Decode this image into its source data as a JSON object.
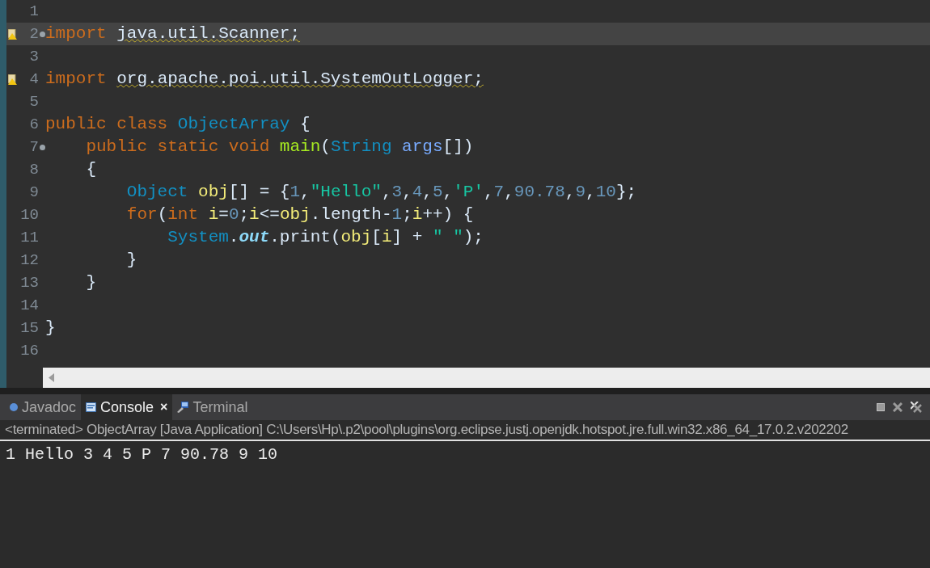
{
  "editor": {
    "lines": [
      {
        "number": "1",
        "current": false,
        "warning": false,
        "fold": false
      },
      {
        "number": "2",
        "current": true,
        "warning": true,
        "fold": true,
        "tokens": [
          {
            "kind": "keyword",
            "text": "import "
          },
          {
            "kind": "warned",
            "text": "java.util.Scanner;"
          }
        ]
      },
      {
        "number": "3",
        "current": false,
        "warning": false,
        "fold": false
      },
      {
        "number": "4",
        "current": false,
        "warning": true,
        "fold": false,
        "tokens": [
          {
            "kind": "keyword",
            "text": "import "
          },
          {
            "kind": "warned",
            "text": "org.apache.poi.util.SystemOutLogger;"
          }
        ]
      },
      {
        "number": "5",
        "current": false,
        "warning": false,
        "fold": false
      },
      {
        "number": "6",
        "current": false,
        "warning": false,
        "fold": false,
        "tokens": [
          {
            "kind": "keyword",
            "text": "public class "
          },
          {
            "kind": "type",
            "text": "ObjectArray"
          },
          {
            "kind": "plain",
            "text": " {"
          }
        ]
      },
      {
        "number": "7",
        "current": false,
        "warning": false,
        "fold": true,
        "tokens": [
          {
            "kind": "keyword",
            "text": "    public static void "
          },
          {
            "kind": "method",
            "text": "main"
          },
          {
            "kind": "plain",
            "text": "("
          },
          {
            "kind": "type",
            "text": "String "
          },
          {
            "kind": "param",
            "text": "args"
          },
          {
            "kind": "plain",
            "text": "[])"
          }
        ]
      },
      {
        "number": "8",
        "current": false,
        "warning": false,
        "fold": false,
        "tokens": [
          {
            "kind": "plain",
            "text": "    {"
          }
        ]
      },
      {
        "number": "9",
        "current": false,
        "warning": false,
        "fold": false,
        "tokens": [
          {
            "kind": "type",
            "text": "        Object "
          },
          {
            "kind": "variable",
            "text": "obj"
          },
          {
            "kind": "plain",
            "text": "[] = {"
          },
          {
            "kind": "number",
            "text": "1"
          },
          {
            "kind": "plain",
            "text": ","
          },
          {
            "kind": "string",
            "text": "\"Hello\""
          },
          {
            "kind": "plain",
            "text": ","
          },
          {
            "kind": "number",
            "text": "3"
          },
          {
            "kind": "plain",
            "text": ","
          },
          {
            "kind": "number",
            "text": "4"
          },
          {
            "kind": "plain",
            "text": ","
          },
          {
            "kind": "number",
            "text": "5"
          },
          {
            "kind": "plain",
            "text": ","
          },
          {
            "kind": "string",
            "text": "'P'"
          },
          {
            "kind": "plain",
            "text": ","
          },
          {
            "kind": "number",
            "text": "7"
          },
          {
            "kind": "plain",
            "text": ","
          },
          {
            "kind": "number",
            "text": "90.78"
          },
          {
            "kind": "plain",
            "text": ","
          },
          {
            "kind": "number",
            "text": "9"
          },
          {
            "kind": "plain",
            "text": ","
          },
          {
            "kind": "number",
            "text": "10"
          },
          {
            "kind": "plain",
            "text": "};"
          }
        ]
      },
      {
        "number": "10",
        "current": false,
        "warning": false,
        "fold": false,
        "tokens": [
          {
            "kind": "keyword",
            "text": "        for"
          },
          {
            "kind": "plain",
            "text": "("
          },
          {
            "kind": "keyword",
            "text": "int "
          },
          {
            "kind": "variable",
            "text": "i"
          },
          {
            "kind": "plain",
            "text": "="
          },
          {
            "kind": "number",
            "text": "0"
          },
          {
            "kind": "plain",
            "text": ";"
          },
          {
            "kind": "variable",
            "text": "i"
          },
          {
            "kind": "plain",
            "text": "<="
          },
          {
            "kind": "variable",
            "text": "obj"
          },
          {
            "kind": "plain",
            "text": ".length-"
          },
          {
            "kind": "number",
            "text": "1"
          },
          {
            "kind": "plain",
            "text": ";"
          },
          {
            "kind": "variable",
            "text": "i"
          },
          {
            "kind": "plain",
            "text": "++) {"
          }
        ]
      },
      {
        "number": "11",
        "current": false,
        "warning": false,
        "fold": false,
        "tokens": [
          {
            "kind": "type",
            "text": "            System"
          },
          {
            "kind": "plain",
            "text": "."
          },
          {
            "kind": "static",
            "text": "out"
          },
          {
            "kind": "plain",
            "text": ".print("
          },
          {
            "kind": "variable",
            "text": "obj"
          },
          {
            "kind": "plain",
            "text": "["
          },
          {
            "kind": "variable",
            "text": "i"
          },
          {
            "kind": "plain",
            "text": "] + "
          },
          {
            "kind": "string",
            "text": "\" \""
          },
          {
            "kind": "plain",
            "text": ");"
          }
        ]
      },
      {
        "number": "12",
        "current": false,
        "warning": false,
        "fold": false,
        "tokens": [
          {
            "kind": "plain",
            "text": "        }"
          }
        ]
      },
      {
        "number": "13",
        "current": false,
        "warning": false,
        "fold": false,
        "tokens": [
          {
            "kind": "plain",
            "text": "    }"
          }
        ]
      },
      {
        "number": "14",
        "current": false,
        "warning": false,
        "fold": false
      },
      {
        "number": "15",
        "current": false,
        "warning": false,
        "fold": false,
        "tokens": [
          {
            "kind": "plain",
            "text": "}"
          }
        ]
      },
      {
        "number": "16",
        "current": false,
        "warning": false,
        "fold": false
      }
    ]
  },
  "tabs": [
    {
      "label": "Javadoc",
      "selected": false,
      "closable": false,
      "kind": "javadoc"
    },
    {
      "label": "Console",
      "selected": true,
      "closable": true,
      "close": "×",
      "kind": "console"
    },
    {
      "label": "Terminal",
      "selected": false,
      "closable": false,
      "kind": "terminal"
    }
  ],
  "console": {
    "header": "<terminated> ObjectArray [Java Application] C:\\Users\\Hp\\.p2\\pool\\plugins\\org.eclipse.justj.openjdk.hotspot.jre.full.win32.x86_64_17.0.2.v202202",
    "output": "1 Hello 3 4 5 P 7 90.78 9 10"
  }
}
